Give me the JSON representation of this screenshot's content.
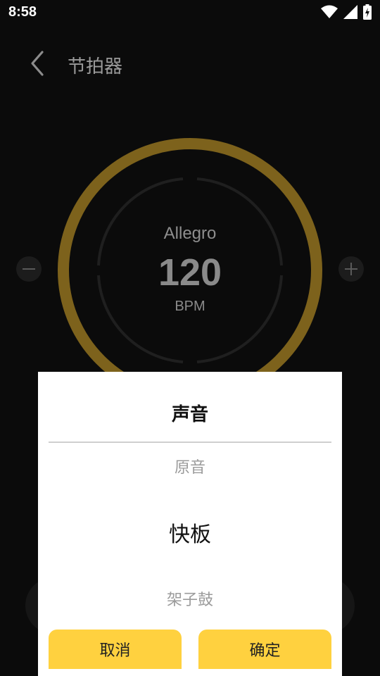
{
  "status_bar": {
    "time": "8:58",
    "icons": [
      "wifi-icon",
      "cellular-signal-icon",
      "battery-charging-icon"
    ]
  },
  "header": {
    "title": "节拍器",
    "back_icon": "chevron-left-icon"
  },
  "metronome": {
    "tempo_name": "Allegro",
    "bpm": "120",
    "unit": "BPM",
    "ring_color": "#8a6b1e",
    "minus_icon": "minus-icon",
    "plus_icon": "plus-icon"
  },
  "sound_dialog": {
    "title": "声音",
    "options": [
      "原音",
      "快板",
      "架子鼓"
    ],
    "selected": "快板",
    "cancel_label": "取消",
    "confirm_label": "确定",
    "button_color": "#ffd13f"
  }
}
